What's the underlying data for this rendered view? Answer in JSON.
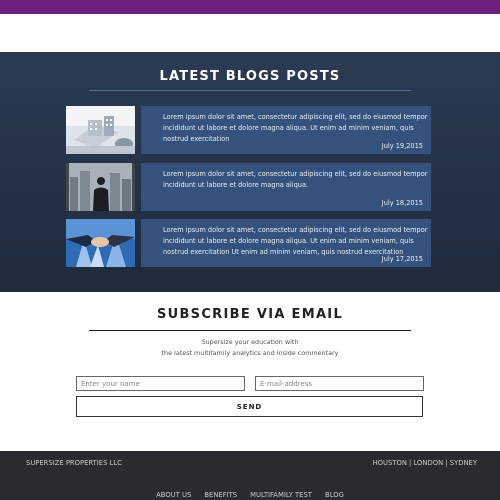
{
  "blogs": {
    "title": "LATEST BLOGS POSTS",
    "posts": [
      {
        "excerpt": "Lorem ipsum dolor sit amet, consectetur adipiscing elit, sed do eiusmod tempor incididunt ut labore et dolore magna aliqua. Ut enim ad minim veniam, quis nostrud exercitation",
        "date": "July 19,2015",
        "image": "office-building-model-image"
      },
      {
        "excerpt": "Lorem ipsum dolor sit amet, consectetur adipiscing elit, sed do eiusmod tempor incididunt ut labore et dolore magna aliqua.",
        "date": "July 18,2015",
        "image": "businessman-skyline-image"
      },
      {
        "excerpt": "Lorem ipsum dolor sit amet, consectetur adipiscing elit, sed do eiusmod tempor incididunt ut labore et dolore magna aliqua. Ut enim ad minim veniam, quis nostrud exercitation Ut enim ad minim veniam, quis nostrud exercitation",
        "date": "July 17,2015",
        "image": "handshake-image"
      }
    ]
  },
  "subscribe": {
    "title": "SUBSCRIBE VIA EMAIL",
    "line1": "Supersize your education with",
    "line2": "the latest multifamily analytics and inside commentary",
    "name_placeholder": "Enter your name",
    "email_placeholder": "E-mail-address",
    "send_label": "SEND"
  },
  "footer": {
    "company": "SUPERSIZE PROPERTIES LLC",
    "cities": "HOUSTON | LONDON | SYDNEY",
    "nav": [
      "ABOUT US",
      "BENEFITS",
      "MULTIFAMILY TEST",
      "BLOG"
    ]
  },
  "colors": {
    "top_bar": "#6c1f7e",
    "blog_section": "#2c3b53",
    "post_card": "#34527b",
    "footer": "#2a2b31"
  }
}
